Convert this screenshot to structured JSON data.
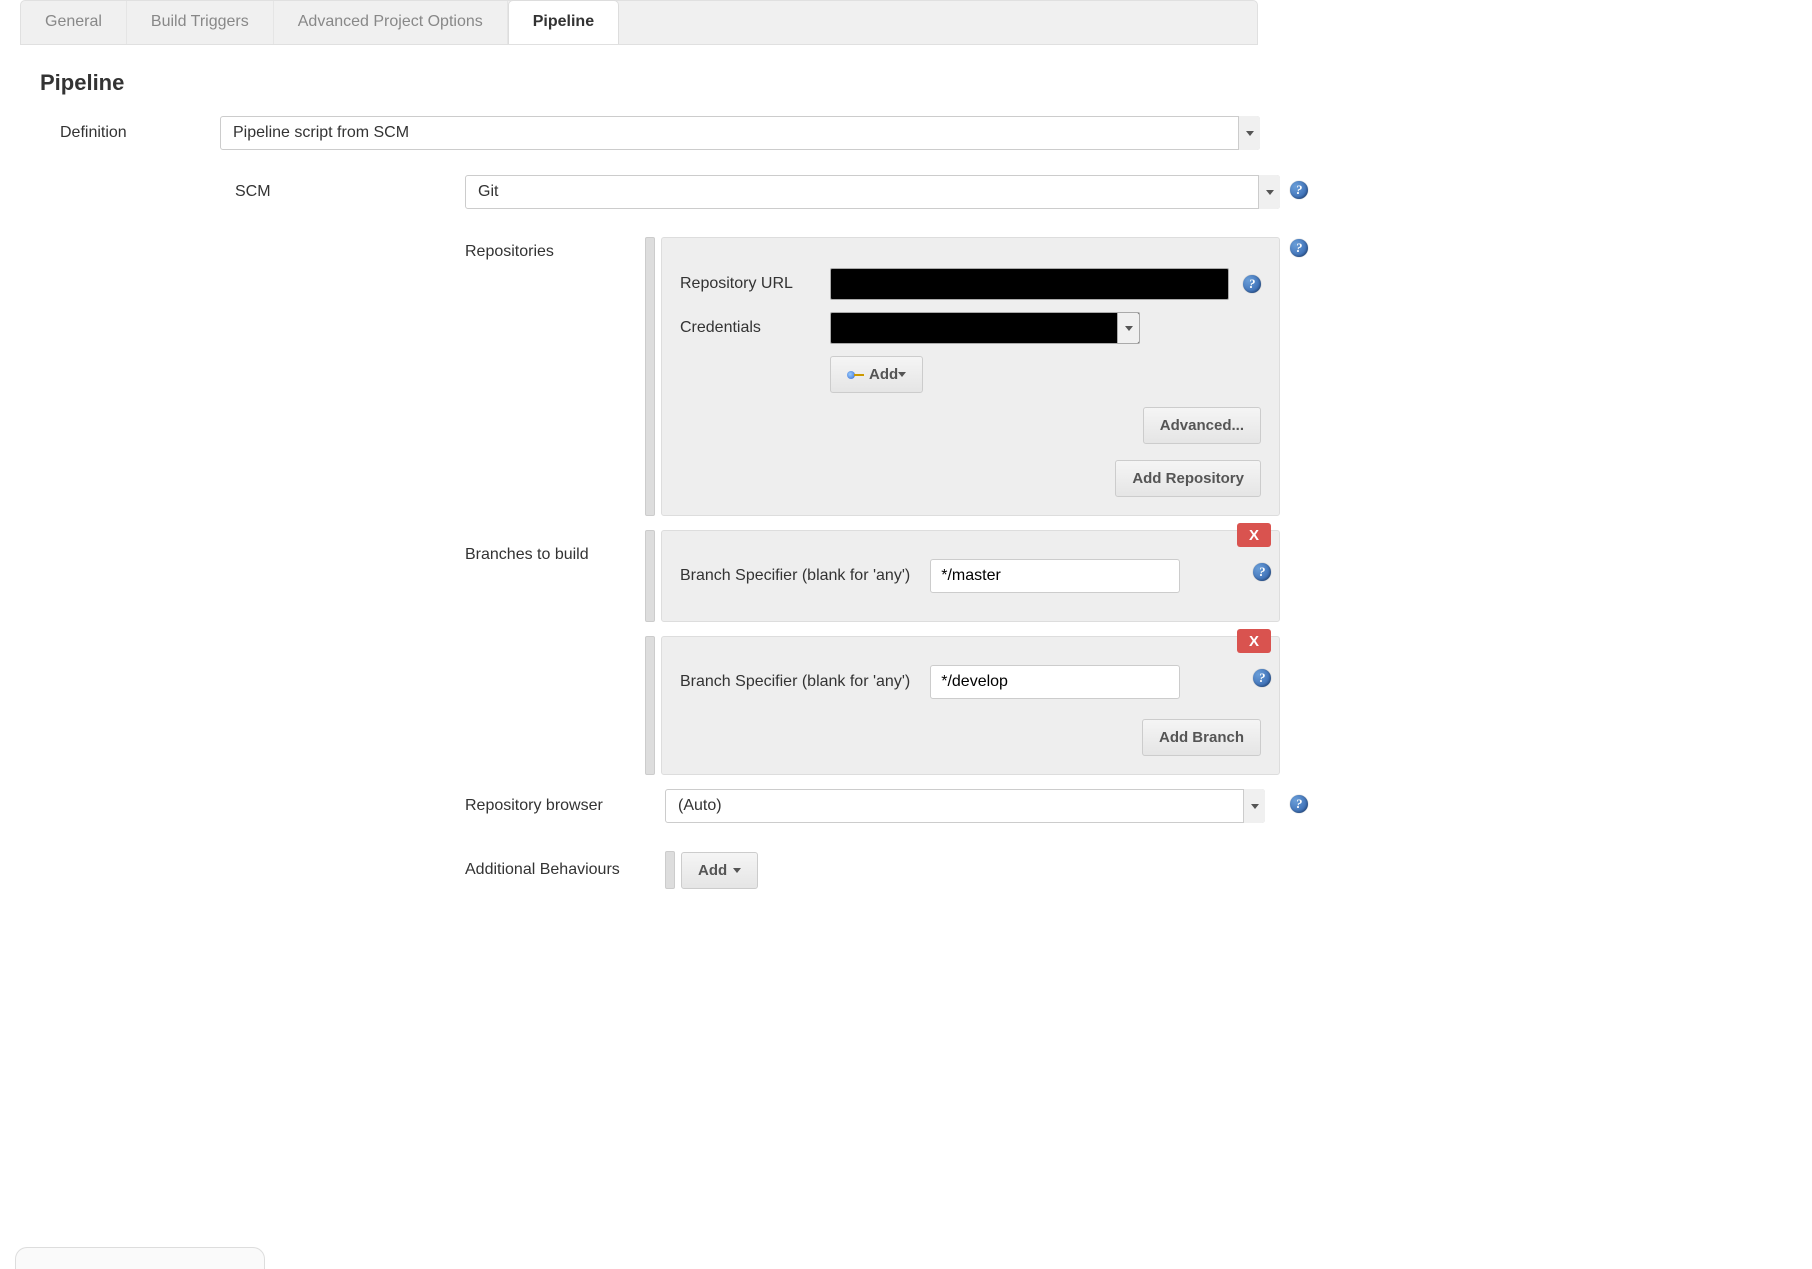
{
  "tabs": {
    "general": "General",
    "build_triggers": "Build Triggers",
    "advanced": "Advanced Project Options",
    "pipeline": "Pipeline"
  },
  "section": {
    "title": "Pipeline"
  },
  "definition": {
    "label": "Definition",
    "value": "Pipeline script from SCM"
  },
  "scm": {
    "label": "SCM",
    "value": "Git"
  },
  "repositories": {
    "label": "Repositories",
    "url_label": "Repository URL",
    "cred_label": "Credentials",
    "add_label": "Add",
    "advanced_btn": "Advanced...",
    "add_repo_btn": "Add Repository"
  },
  "branches": {
    "label": "Branches to build",
    "specifier_label": "Branch Specifier (blank for 'any')",
    "items": [
      "*/master",
      "*/develop"
    ],
    "add_branch_btn": "Add Branch",
    "close": "X"
  },
  "repo_browser": {
    "label": "Repository browser",
    "value": "(Auto)"
  },
  "additional_behaviours": {
    "label": "Additional Behaviours",
    "add_btn": "Add"
  },
  "help_glyph": "?"
}
